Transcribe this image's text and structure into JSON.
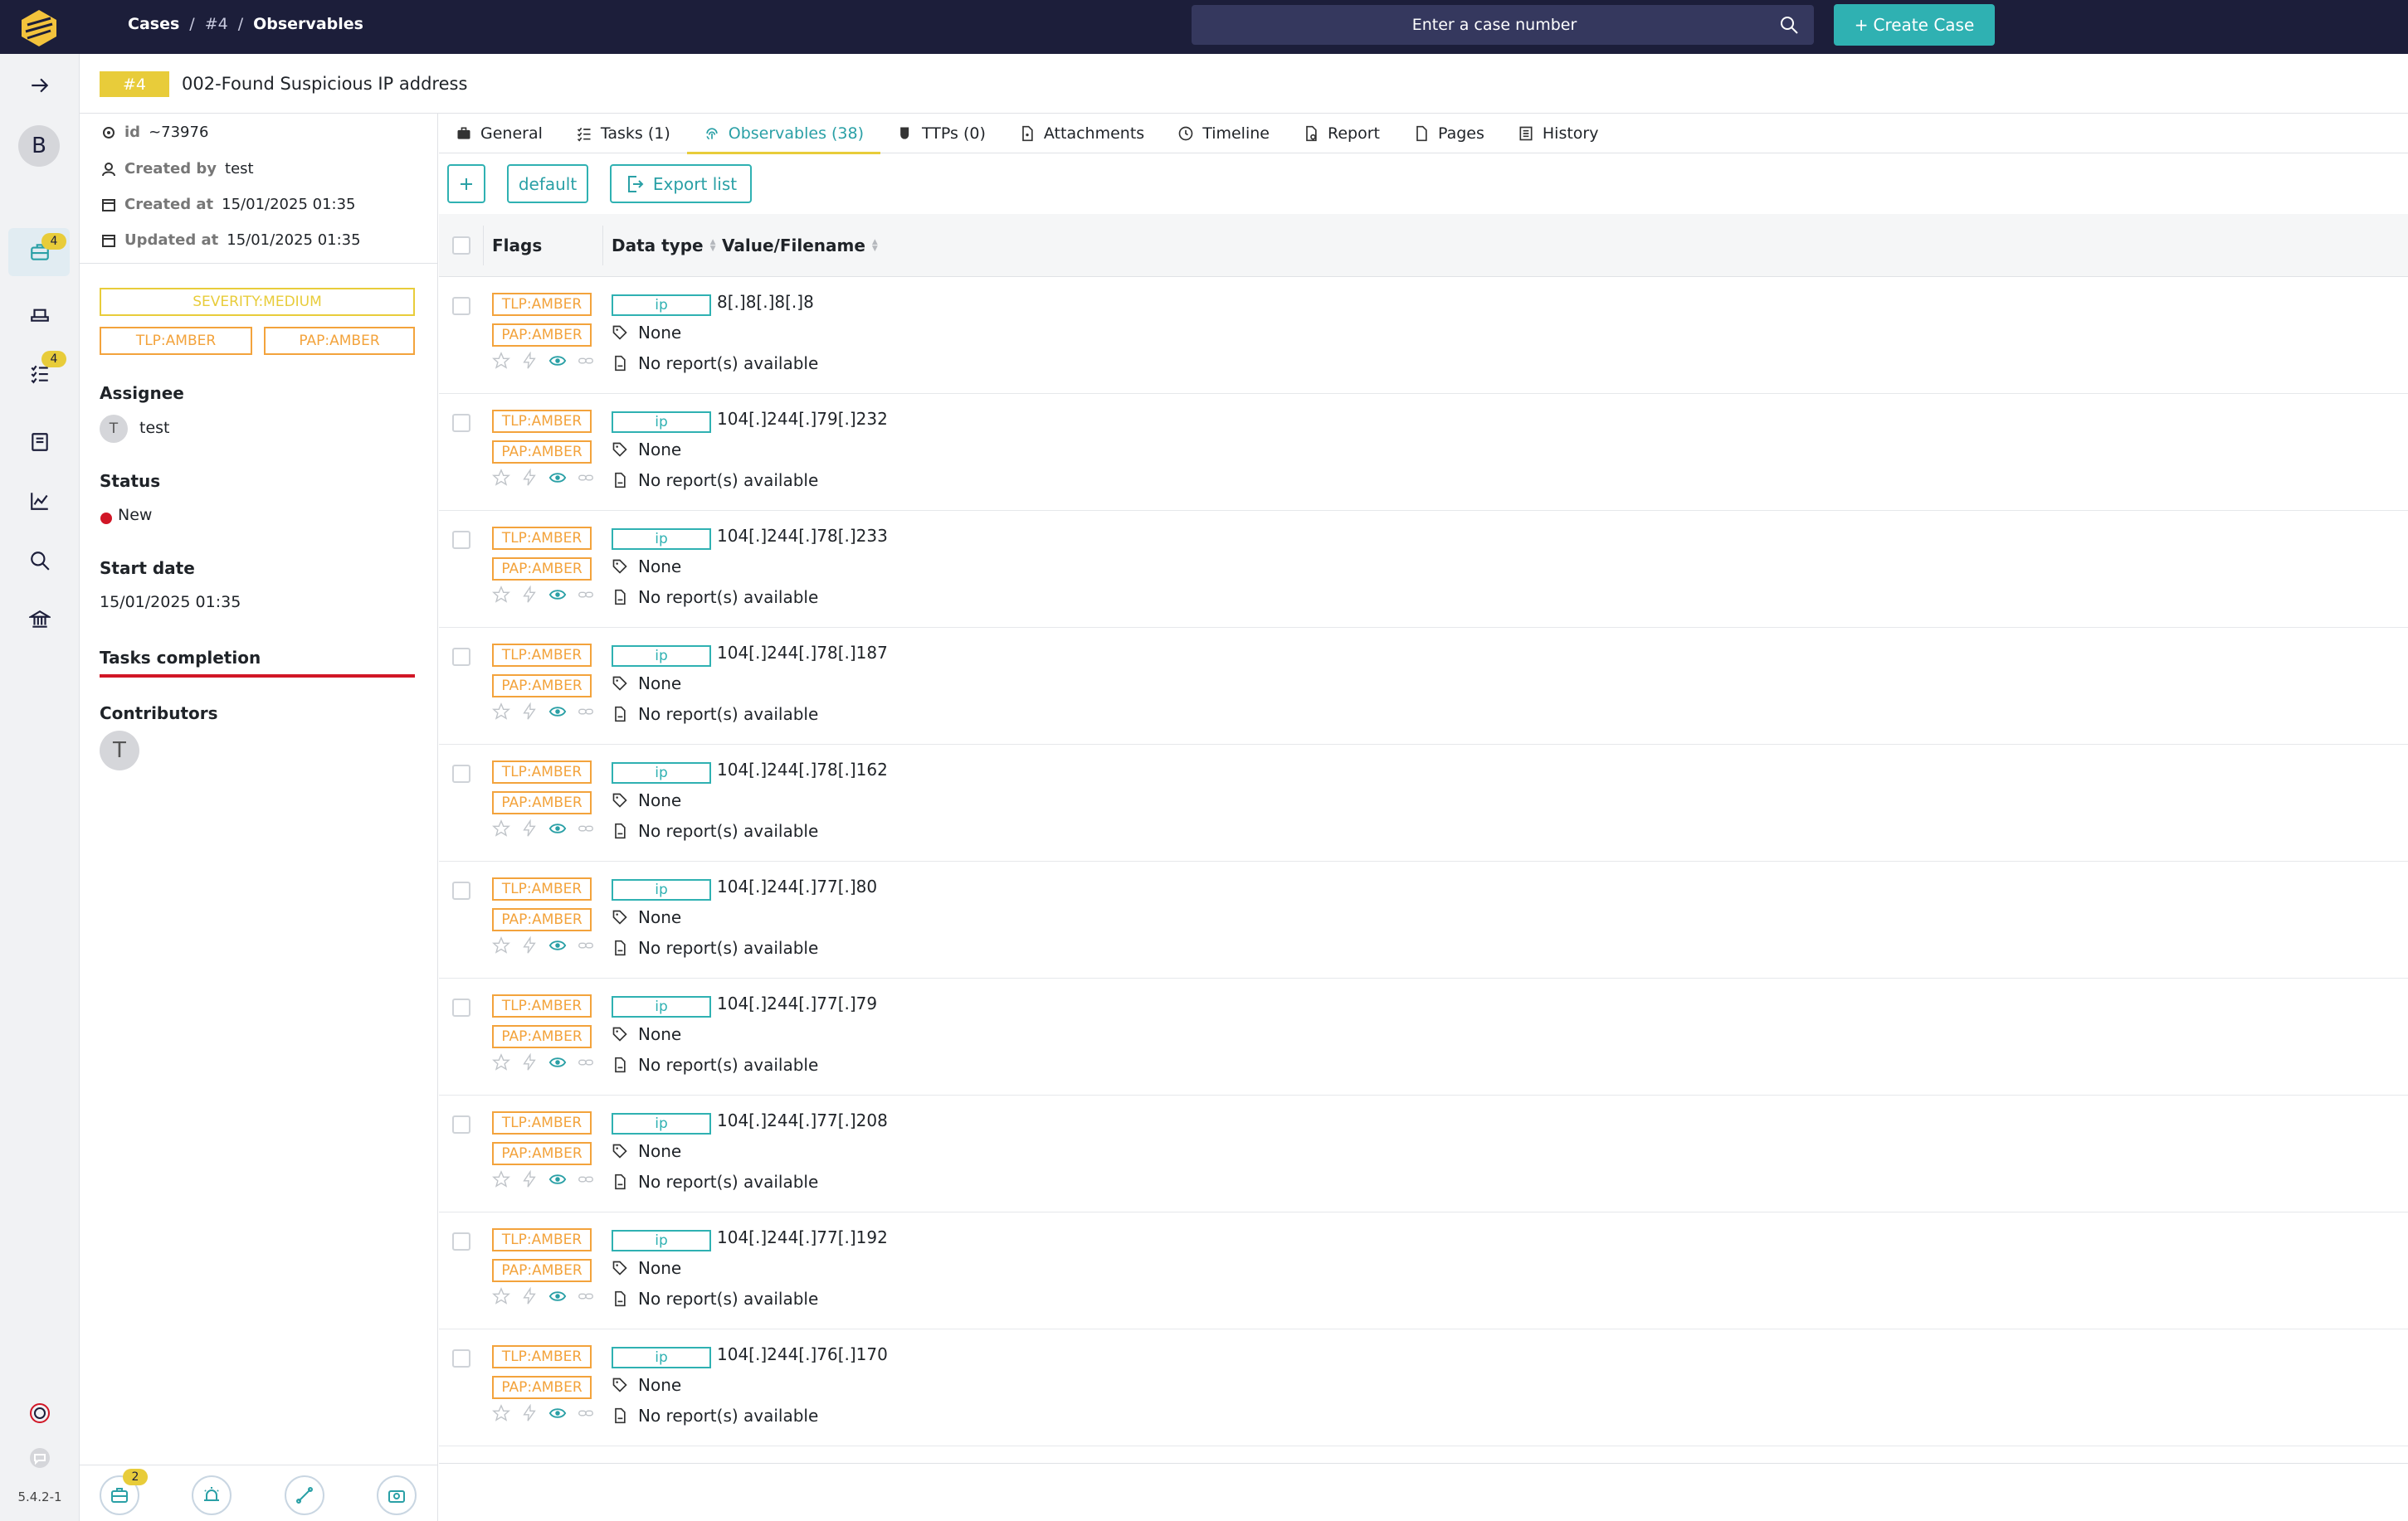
{
  "topbar": {
    "breadcrumb": [
      "Cases",
      "#4",
      "Observables"
    ],
    "search_placeholder": "Enter a case number",
    "create_label": "Create Case"
  },
  "nav": {
    "avatar_letter": "B",
    "cases_badge": "4",
    "tasks_badge": "4",
    "version": "5.4.2-1"
  },
  "case": {
    "number": "#4",
    "title": "002-Found Suspicious IP address",
    "id_label": "id",
    "id": "~73976",
    "created_by_label": "Created by",
    "created_by": "test",
    "created_at_label": "Created at",
    "created_at": "15/01/2025 01:35",
    "updated_at_label": "Updated at",
    "updated_at": "15/01/2025 01:35",
    "severity": "SEVERITY:MEDIUM",
    "tlp": "TLP:AMBER",
    "pap": "PAP:AMBER",
    "assignee_label": "Assignee",
    "assignee_initial": "T",
    "assignee": "test",
    "status_label": "Status",
    "status": "New",
    "start_date_label": "Start date",
    "start_date": "15/01/2025 01:35",
    "tasks_completion_label": "Tasks completion",
    "contributors_label": "Contributors",
    "contributor_initial": "T",
    "bottom_badge": "2"
  },
  "tabs": [
    {
      "label": "General",
      "icon": "briefcase-icon"
    },
    {
      "label": "Tasks (1)",
      "icon": "tasks-icon"
    },
    {
      "label": "Observables (38)",
      "icon": "fingerprint-icon"
    },
    {
      "label": "TTPs (0)",
      "icon": "mask-icon"
    },
    {
      "label": "Attachments",
      "icon": "attachment-icon"
    },
    {
      "label": "Timeline",
      "icon": "clock-icon"
    },
    {
      "label": "Report",
      "icon": "report-icon"
    },
    {
      "label": "Pages",
      "icon": "page-icon"
    },
    {
      "label": "History",
      "icon": "history-icon"
    }
  ],
  "toolbar": {
    "default_label": "default",
    "export_label": "Export list"
  },
  "table": {
    "headers": {
      "flags": "Flags",
      "data_type": "Data type",
      "value": "Value/Filename"
    },
    "rows": [
      {
        "tlp": "TLP:AMBER",
        "pap": "PAP:AMBER",
        "type": "ip",
        "value": "8[.]8[.]8[.]8",
        "tags": "None",
        "reports": "No report(s) available"
      },
      {
        "tlp": "TLP:AMBER",
        "pap": "PAP:AMBER",
        "type": "ip",
        "value": "104[.]244[.]79[.]232",
        "tags": "None",
        "reports": "No report(s) available"
      },
      {
        "tlp": "TLP:AMBER",
        "pap": "PAP:AMBER",
        "type": "ip",
        "value": "104[.]244[.]78[.]233",
        "tags": "None",
        "reports": "No report(s) available"
      },
      {
        "tlp": "TLP:AMBER",
        "pap": "PAP:AMBER",
        "type": "ip",
        "value": "104[.]244[.]78[.]187",
        "tags": "None",
        "reports": "No report(s) available"
      },
      {
        "tlp": "TLP:AMBER",
        "pap": "PAP:AMBER",
        "type": "ip",
        "value": "104[.]244[.]78[.]162",
        "tags": "None",
        "reports": "No report(s) available"
      },
      {
        "tlp": "TLP:AMBER",
        "pap": "PAP:AMBER",
        "type": "ip",
        "value": "104[.]244[.]77[.]80",
        "tags": "None",
        "reports": "No report(s) available"
      },
      {
        "tlp": "TLP:AMBER",
        "pap": "PAP:AMBER",
        "type": "ip",
        "value": "104[.]244[.]77[.]79",
        "tags": "None",
        "reports": "No report(s) available"
      },
      {
        "tlp": "TLP:AMBER",
        "pap": "PAP:AMBER",
        "type": "ip",
        "value": "104[.]244[.]77[.]208",
        "tags": "None",
        "reports": "No report(s) available"
      },
      {
        "tlp": "TLP:AMBER",
        "pap": "PAP:AMBER",
        "type": "ip",
        "value": "104[.]244[.]77[.]192",
        "tags": "None",
        "reports": "No report(s) available"
      },
      {
        "tlp": "TLP:AMBER",
        "pap": "PAP:AMBER",
        "type": "ip",
        "value": "104[.]244[.]76[.]170",
        "tags": "None",
        "reports": "No report(s) available"
      }
    ]
  },
  "colors": {
    "topbar": "#1c1e3a",
    "accent": "#2fb1b2",
    "amber": "#f3a33c",
    "yellow": "#e8cc3a",
    "status_new": "#d11626"
  }
}
